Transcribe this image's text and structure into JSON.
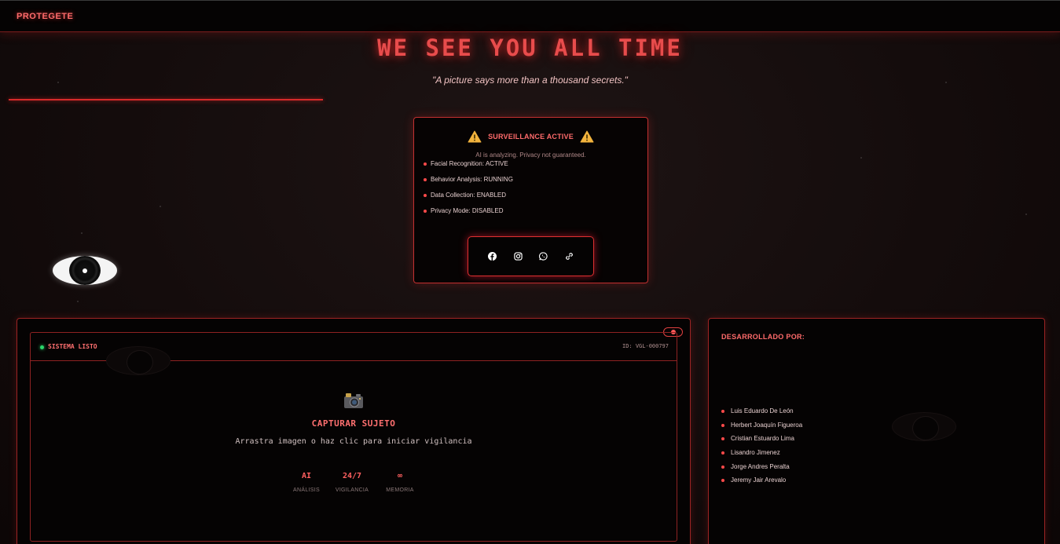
{
  "app": {
    "brand": "PROTEGETE"
  },
  "hero": {
    "title": "WE SEE YOU ALL TIME",
    "quote": "\"A picture says more than a thousand secrets.\""
  },
  "surveillance": {
    "title": "SURVEILLANCE ACTIVE",
    "subtitle": "AI is analyzing. Privacy not guaranteed.",
    "items": [
      "Facial Recognition: ACTIVE",
      "Behavior Analysis: RUNNING",
      "Data Collection: ENABLED",
      "Privacy Mode: DISABLED"
    ],
    "social_icons": [
      "facebook-icon",
      "instagram-icon",
      "whatsapp-icon",
      "link-icon"
    ]
  },
  "capture": {
    "status": "SISTEMA LISTO",
    "session_id": "ID: VGL-000797",
    "title": "CAPTURAR SUJETO",
    "subtitle": "Arrastra imagen o haz clic para iniciar vigilancia",
    "stats": [
      {
        "value": "AI",
        "label": "ANÁLISIS"
      },
      {
        "value": "24/7",
        "label": "VIGILANCIA"
      },
      {
        "value": "∞",
        "label": "MEMORIA"
      }
    ]
  },
  "developers": {
    "title": "DESARROLLADO POR:",
    "names": [
      "Luis Eduardo De León",
      "Herbert Joaquín Figueroa",
      "Cristian Estuardo Lima",
      "Lisandro Jimenez",
      "Jorge Andres Peralta",
      "Jeremy Jair Arevalo"
    ]
  },
  "colors": {
    "accent": "#ff4a4a",
    "border": "#c23030",
    "status_ok": "#2bd66a",
    "background": "#140c0c"
  }
}
